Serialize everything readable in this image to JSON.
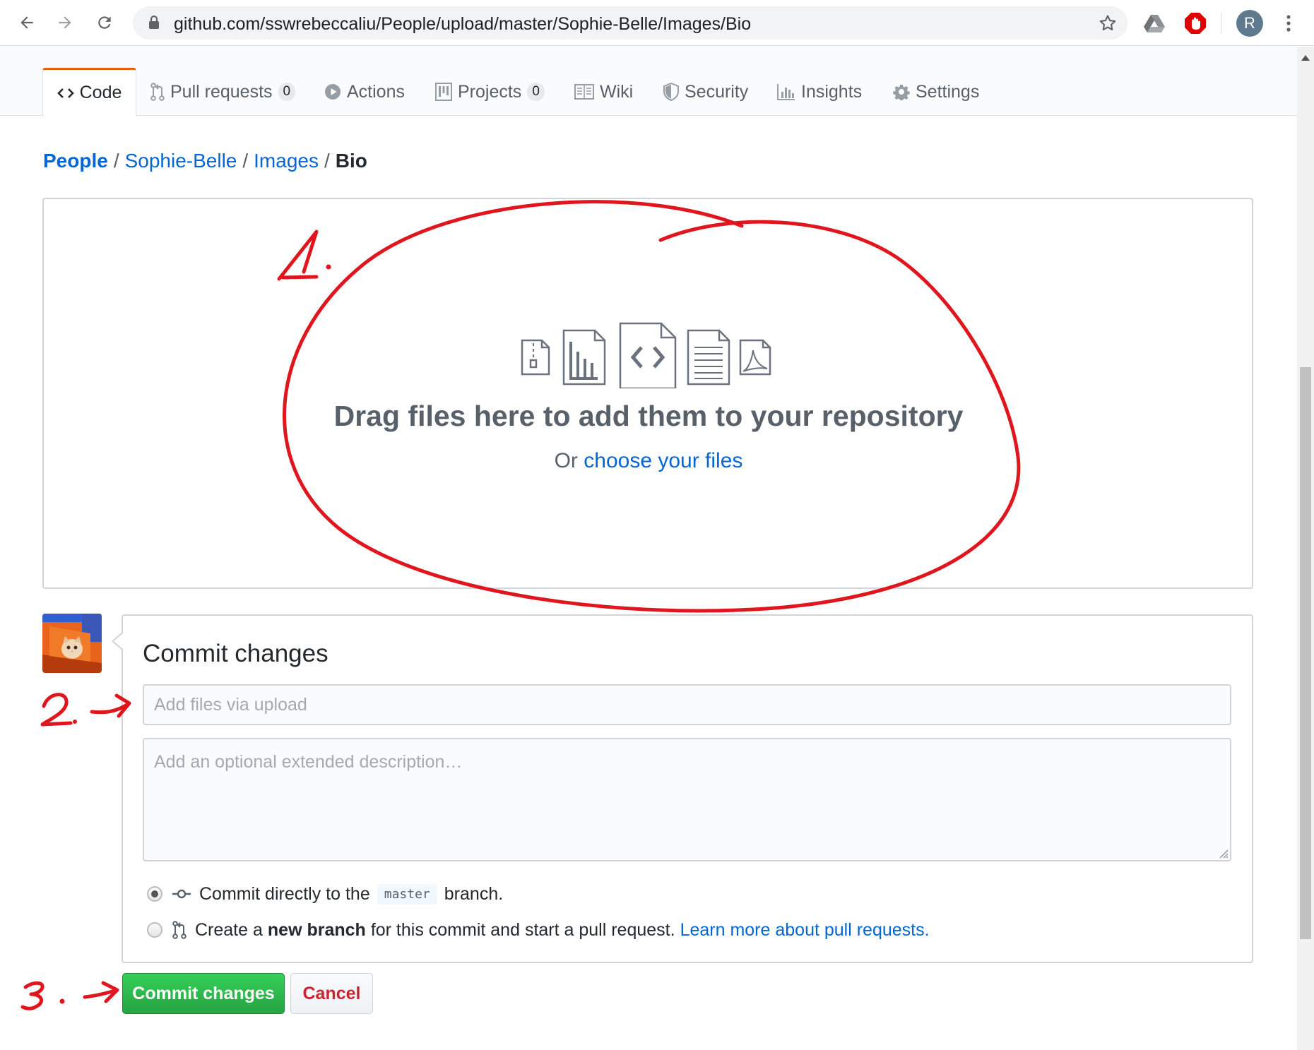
{
  "browser": {
    "url": "github.com/sswrebeccaliu/People/upload/master/Sophie-Belle/Images/Bio",
    "profile_initial": "R"
  },
  "repo_nav": {
    "tabs": [
      {
        "label": "Code",
        "icon": "code-icon",
        "selected": true
      },
      {
        "label": "Pull requests",
        "icon": "git-pull-request-icon",
        "count": "0"
      },
      {
        "label": "Actions",
        "icon": "play-icon"
      },
      {
        "label": "Projects",
        "icon": "project-icon",
        "count": "0"
      },
      {
        "label": "Wiki",
        "icon": "book-icon"
      },
      {
        "label": "Security",
        "icon": "shield-icon"
      },
      {
        "label": "Insights",
        "icon": "graph-icon"
      },
      {
        "label": "Settings",
        "icon": "gear-icon"
      }
    ]
  },
  "breadcrumb": {
    "root": "People",
    "items": [
      "Sophie-Belle",
      "Images"
    ],
    "current": "Bio",
    "separator": "/"
  },
  "dropzone": {
    "title": "Drag files here to add them to your repository",
    "or_text": "Or",
    "choose_link": "choose your files"
  },
  "commit": {
    "heading": "Commit changes",
    "summary_placeholder": "Add files via upload",
    "description_placeholder": "Add an optional extended description…",
    "option_direct_prefix": "Commit directly to the",
    "branch_name": "master",
    "option_direct_suffix": "branch.",
    "option_new_prefix": "Create a",
    "option_new_bold": "new branch",
    "option_new_suffix": "for this commit and start a pull request.",
    "learn_more_link": "Learn more about pull requests.",
    "submit_label": "Commit changes",
    "cancel_label": "Cancel"
  },
  "annotations": {
    "step1": "1.",
    "step2": "2.",
    "step3": "3.",
    "color": "#e0161e"
  },
  "colors": {
    "link": "#0366d6",
    "primary_button": "#28a745",
    "cancel_text": "#cb2431",
    "selected_tab_accent": "#e36209"
  }
}
